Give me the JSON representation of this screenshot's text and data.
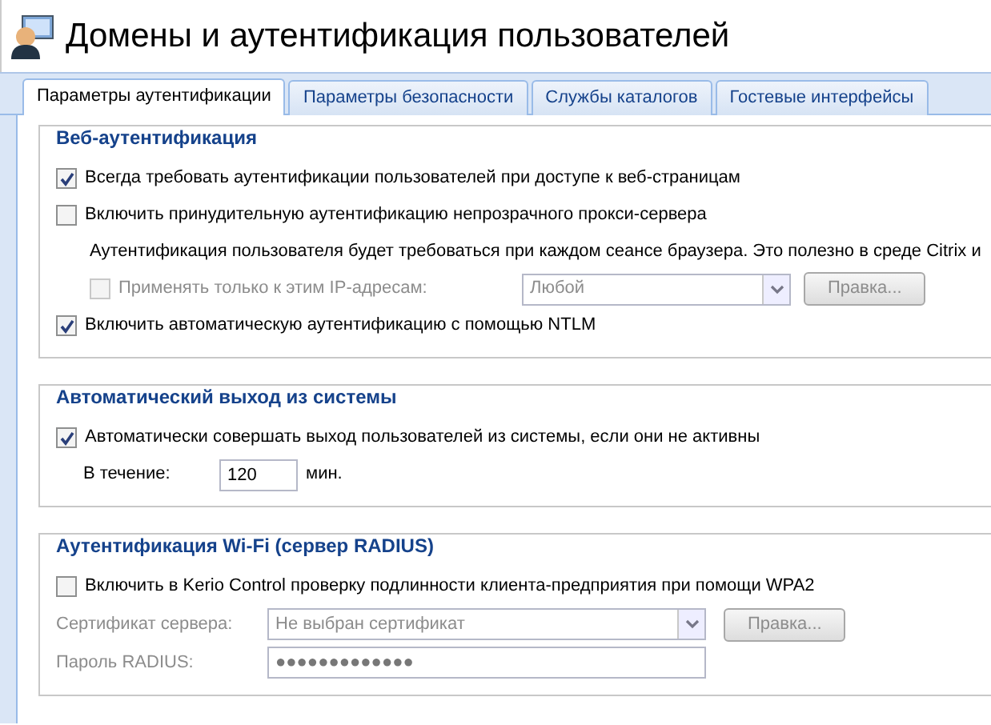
{
  "window": {
    "title": "Домены и аутентификация пользователей"
  },
  "tabs": [
    {
      "label": "Параметры аутентификации",
      "selected": true
    },
    {
      "label": "Параметры безопасности",
      "selected": false
    },
    {
      "label": "Службы каталогов",
      "selected": false
    },
    {
      "label": "Гостевые интерфейсы",
      "selected": false
    }
  ],
  "sections": [
    {
      "title": "Веб-аутентификация",
      "rows": [
        {
          "kind": "checkbox",
          "label": "Всегда требовать аутентификации пользователей при доступе к веб-страницам",
          "checked": true,
          "disabled": false
        },
        {
          "kind": "checkbox",
          "label": "Включить принудительную аутентификацию непрозрачного прокси-сервера",
          "checked": false,
          "disabled": false
        },
        {
          "kind": "note",
          "text": "Аутентификация пользователя будет требоваться при каждом сеансе браузера. Это полезно в среде Citrix и"
        },
        {
          "kind": "ip_filter",
          "label": "Применять только к этим IP-адресам:",
          "checked": false,
          "disabled": true,
          "value": "Любой",
          "button": "Правка..."
        },
        {
          "kind": "checkbox",
          "label": "Включить автоматическую аутентификацию с помощью NTLM",
          "checked": true,
          "disabled": false
        }
      ]
    },
    {
      "title": "Автоматический выход из системы",
      "rows": [
        {
          "kind": "checkbox",
          "label": "Автоматически совершать выход пользователей из системы, если они не активны",
          "checked": true,
          "disabled": false
        },
        {
          "kind": "number",
          "label": "В течение:",
          "value": "120",
          "unit": "мин."
        }
      ]
    },
    {
      "title": "Аутентификация Wi-Fi (сервер RADIUS)",
      "rows": [
        {
          "kind": "checkbox",
          "label": "Включить в Kerio Control проверку подлинности клиента-предприятия при помощи WPA2",
          "checked": false,
          "disabled": false
        },
        {
          "kind": "select",
          "label": "Сертификат сервера:",
          "value": "Не выбран сертификат",
          "button": "Правка...",
          "disabled": true
        },
        {
          "kind": "password",
          "label": "Пароль RADIUS:",
          "value": "●●●●●●●●●●●●●",
          "disabled": true
        }
      ]
    }
  ]
}
